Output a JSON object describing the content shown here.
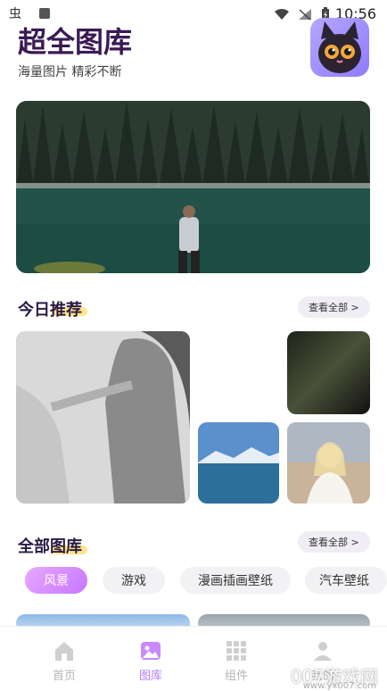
{
  "status": {
    "time": "10:56",
    "left_icons": "虫"
  },
  "header": {
    "title": "超全图库",
    "subtitle": "海量图片 精彩不断"
  },
  "today": {
    "title": "今日推荐",
    "more": "查看全部 >"
  },
  "all": {
    "title": "全部图库",
    "more": "查看全部 >"
  },
  "chips": [
    "风景",
    "游戏",
    "漫画插画壁纸",
    "汽车壁纸"
  ],
  "active_chip_index": 0,
  "tabs": [
    {
      "label": "首页",
      "icon": "home-icon"
    },
    {
      "label": "图库",
      "icon": "gallery-icon"
    },
    {
      "label": "组件",
      "icon": "grid-icon"
    },
    {
      "label": "我的",
      "icon": "profile-icon"
    }
  ],
  "active_tab_index": 1,
  "watermark": {
    "main": "007游戏网",
    "sub": "www.yx007.com"
  },
  "colors": {
    "accent": "#b37bff",
    "title": "#3a1a55",
    "highlight": "#ffe07a"
  }
}
